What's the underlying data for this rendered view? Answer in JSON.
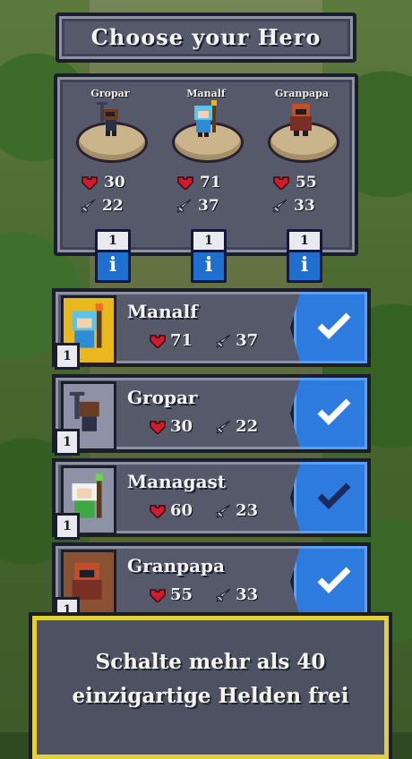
{
  "title": "Choose your Hero",
  "heroes_top": [
    {
      "name": "Gropar",
      "hp": "30",
      "atk": "22",
      "count": "1"
    },
    {
      "name": "Manalf",
      "hp": "71",
      "atk": "37",
      "count": "1"
    },
    {
      "name": "Granpapa",
      "hp": "55",
      "atk": "33",
      "count": "1"
    }
  ],
  "info_glyph": "i",
  "hero_list": [
    {
      "name": "Manalf",
      "hp": "71",
      "atk": "37",
      "count": "1",
      "checked": true
    },
    {
      "name": "Gropar",
      "hp": "30",
      "atk": "22",
      "count": "1",
      "checked": true
    },
    {
      "name": "Managast",
      "hp": "60",
      "atk": "23",
      "count": "1",
      "checked": false
    },
    {
      "name": "Granpapa",
      "hp": "55",
      "atk": "33",
      "count": "1",
      "checked": true
    }
  ],
  "banner": {
    "line1": "Schalte mehr als 40",
    "line2": "einzigartige Helden frei"
  },
  "colors": {
    "accent_blue": "#2e7be0",
    "panel": "#55596a",
    "banner_border": "#e3cf3a"
  }
}
